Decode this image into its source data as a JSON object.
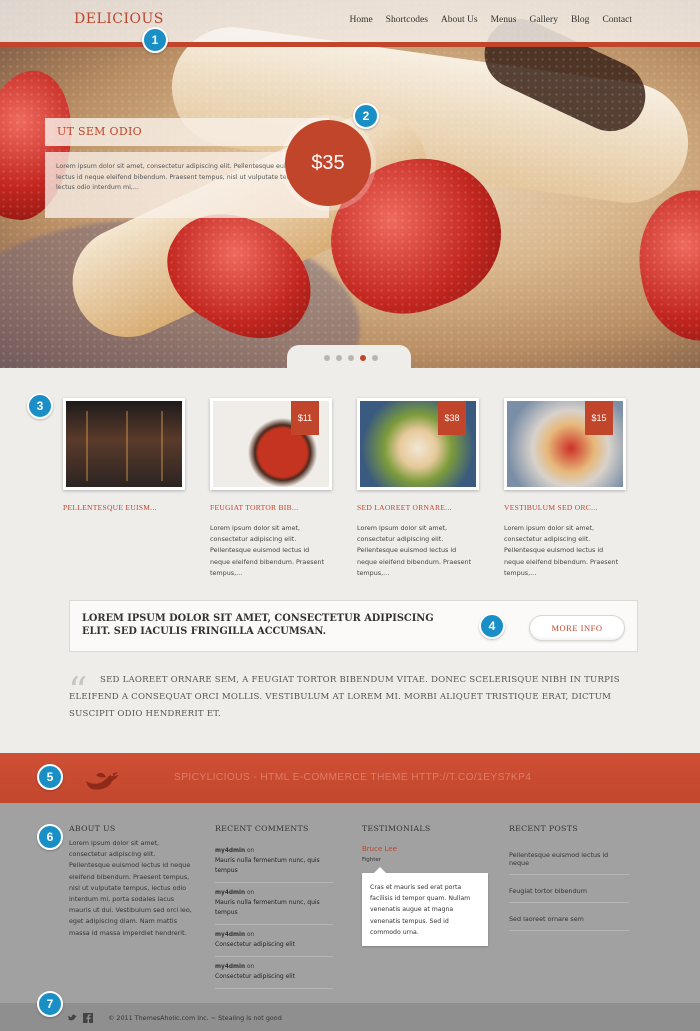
{
  "header": {
    "logo": "DELICIOUS",
    "nav": [
      "Home",
      "Shortcodes",
      "About Us",
      "Menus",
      "Gallery",
      "Blog",
      "Contact"
    ]
  },
  "slider": {
    "title": "UT SEM ODIO",
    "text": "Lorem ipsum dolor sit amet, consectetur adipiscing elit. Pellentesque euismod lectus id neque eleifend bibendum. Praesent tempus, nisl ut vulputate tempus, lectus odio interdum mi,...",
    "price": "$35",
    "slide_count": 5,
    "active_slide": 4
  },
  "markers": [
    "1",
    "2",
    "3",
    "4",
    "5",
    "6",
    "7"
  ],
  "products": [
    {
      "title": "PELLENTESQUE EUISM...",
      "price": "",
      "desc": ""
    },
    {
      "title": "FEUGIAT TORTOR BIB...",
      "price": "$11",
      "desc": "Lorem ipsum dolor sit amet, consectetur adipiscing elit. Pellentesque euismod lectus id neque eleifend bibendum. Praesent tempus,..."
    },
    {
      "title": "SED LAOREET ORNARE...",
      "price": "$38",
      "desc": "Lorem ipsum dolor sit amet, consectetur adipiscing elit. Pellentesque euismod lectus id neque eleifend bibendum. Praesent tempus,..."
    },
    {
      "title": "VESTIBULUM SED ORC...",
      "price": "$15",
      "desc": "Lorem ipsum dolor sit amet, consectetur adipiscing elit. Pellentesque euismod lectus id neque eleifend bibendum. Praesent tempus,..."
    }
  ],
  "cta": {
    "text": "LOREM IPSUM DOLOR SIT AMET, CONSECTETUR ADIPISCING ELIT. SED IACULIS FRINGILLA ACCUMSAN.",
    "button": "MORE INFO"
  },
  "quote": {
    "mark": "“",
    "text": "SED LAOREET ORNARE SEM, A FEUGIAT TORTOR BIBENDUM VITAE. DONEC SCELERISQUE NIBH IN TURPIS ELEIFEND A CONSEQUAT ORCI MOLLIS. VESTIBULUM AT LOREM MI. MORBI ALIQUET TRISTIQUE ERAT, DICTUM SUSCIPIT ODIO HENDRERIT ET."
  },
  "twitter": {
    "text": "SPICYLICIOUS - HTML E-COMMERCE THEME HTTP://T.CO/1EYS7KP4"
  },
  "footer": {
    "about": {
      "heading": "ABOUT US",
      "text": "Lorem ipsum dolor sit amet, consectetur adipiscing elit. Pellentesque euismod lectus id neque eleifend bibendum. Praesent tempus, nisl ut vulputate tempus, lectus odio interdum mi, porta sodales lacus mauris ut dui. Vestibulum sed orci leo, eget adipiscing diam. Nam mattis massa id massa imperdiet hendrerit."
    },
    "comments": {
      "heading": "RECENT COMMENTS",
      "items": [
        {
          "author": "my4dmin",
          "on": "on",
          "text": "Mauris nulla fermentum nunc, quis tempus"
        },
        {
          "author": "my4dmin",
          "on": "on",
          "text": "Mauris nulla fermentum nunc, quis tempus"
        },
        {
          "author": "my4dmin",
          "on": "on",
          "text": "Consectetur adipiscing elit"
        },
        {
          "author": "my4dmin",
          "on": "on",
          "text": "Consectetur adipiscing elit"
        }
      ]
    },
    "testimonials": {
      "heading": "TESTIMONIALS",
      "name": "Bruce Lee",
      "role": "Fighter",
      "text": "Cras et mauris sed erat porta facilisis id tempor quam. Nullam venenatis augue at magna venenatis tempus. Sed id commodo urna."
    },
    "posts": {
      "heading": "RECENT POSTS",
      "items": [
        "Pellentesque euismod lectus id neque",
        "Feugiat tortor bibendum",
        "Sed laoreet ornare sem"
      ]
    }
  },
  "bottom": {
    "copyright": "© 2011 ThemesAholic.com Inc. ~ Stealing is not good"
  },
  "colors": {
    "accent": "#c0452b",
    "marker": "#1a8fc6",
    "footer": "#a2a1a1"
  }
}
